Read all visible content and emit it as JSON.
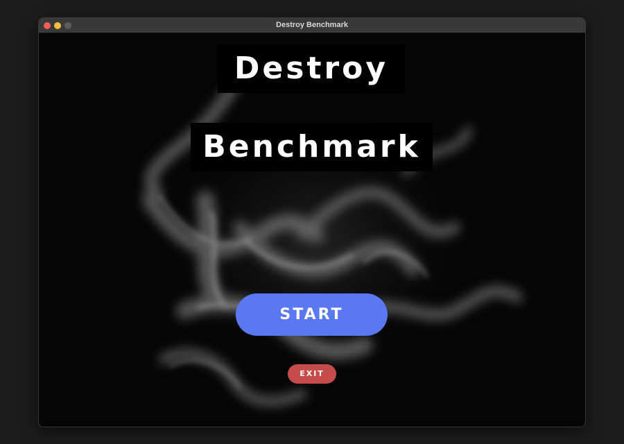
{
  "window": {
    "title": "Destroy Benchmark"
  },
  "main": {
    "title_line1": "Destroy",
    "title_line2": "Benchmark",
    "start_label": "START",
    "exit_label": "EXIT"
  },
  "colors": {
    "start_button": "#5b78f3",
    "exit_button": "#c64c4c",
    "background": "#050505",
    "close_light": "#ed5f57",
    "minimize_light": "#f4bd3a",
    "maximize_light": "#5c5c5c"
  }
}
